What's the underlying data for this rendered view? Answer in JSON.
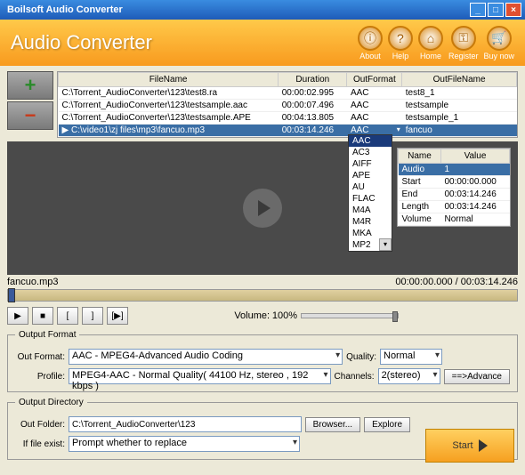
{
  "titlebar": {
    "title": "Boilsoft Audio Converter"
  },
  "header": {
    "title": "Audio Converter",
    "buttons": [
      {
        "label": "About",
        "icon": "ⓘ"
      },
      {
        "label": "Help",
        "icon": "?"
      },
      {
        "label": "Home",
        "icon": "⌂"
      },
      {
        "label": "Register",
        "icon": "⚿"
      },
      {
        "label": "Buy now",
        "icon": "🛒"
      }
    ]
  },
  "file_table": {
    "columns": [
      "FileName",
      "Duration",
      "OutFormat",
      "OutFileName"
    ],
    "rows": [
      {
        "file": "C:\\Torrent_AudioConverter\\123\\test8.ra",
        "dur": "00:00:02.995",
        "fmt": "AAC",
        "out": "test8_1"
      },
      {
        "file": "C:\\Torrent_AudioConverter\\123\\testsample.aac",
        "dur": "00:00:07.496",
        "fmt": "AAC",
        "out": "testsample"
      },
      {
        "file": "C:\\Torrent_AudioConverter\\123\\testsample.APE",
        "dur": "00:04:13.805",
        "fmt": "AAC",
        "out": "testsample_1"
      },
      {
        "file": "C:\\video1\\zj files\\mp3\\fancuo.mp3",
        "dur": "00:03:14.246",
        "fmt": "AAC",
        "out": "fancuo"
      }
    ],
    "selected": 3
  },
  "format_options": [
    "AAC",
    "AC3",
    "AIFF",
    "APE",
    "AU",
    "FLAC",
    "M4A",
    "M4R",
    "MKA",
    "MP2"
  ],
  "format_selected": "AAC",
  "props": {
    "columns": [
      "Name",
      "Value"
    ],
    "rows": [
      {
        "name": "Audio",
        "value": "1"
      },
      {
        "name": "Start",
        "value": "00:00:00.000"
      },
      {
        "name": "End",
        "value": "00:03:14.246"
      },
      {
        "name": "Length",
        "value": "00:03:14.246"
      },
      {
        "name": "Volume",
        "value": "Normal"
      }
    ]
  },
  "preview": {
    "filename": "fancuo.mp3",
    "time": "00:00:00.000 / 00:03:14.246"
  },
  "volume": {
    "label": "Volume:",
    "value": "100%"
  },
  "output_format": {
    "legend": "Output Format",
    "format_label": "Out Format:",
    "format_value": "AAC - MPEG4-Advanced Audio Coding",
    "profile_label": "Profile:",
    "profile_value": "MPEG4-AAC - Normal Quality( 44100 Hz, stereo , 192 kbps )",
    "quality_label": "Quality:",
    "quality_value": "Normal",
    "channels_label": "Channels:",
    "channels_value": "2(stereo)",
    "advance": "==>Advance"
  },
  "output_dir": {
    "legend": "Output Directory",
    "folder_label": "Out Folder:",
    "folder_value": "C:\\Torrent_AudioConverter\\123",
    "browse": "Browser...",
    "explore": "Explore",
    "exist_label": "If file exist:",
    "exist_value": "Prompt whether to replace"
  },
  "start": "Start"
}
